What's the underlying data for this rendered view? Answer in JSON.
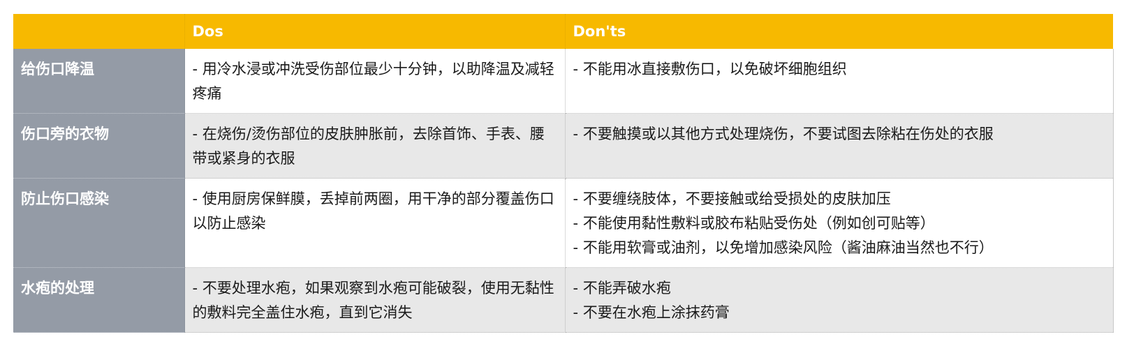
{
  "table": {
    "headers": [
      "",
      "Dos",
      "Don'ts"
    ],
    "rows": [
      {
        "label": "给伤口降温",
        "dos": [
          "- 用冷水浸或冲洗受伤部位最少十分钟，以助降温及减轻疼痛"
        ],
        "donts": [
          "- 不能用冰直接敷伤口，以免破坏细胞组织"
        ]
      },
      {
        "label": "伤口旁的衣物",
        "dos": [
          "- 在烧伤/烫伤部位的皮肤肿胀前，去除首饰、手表、腰带或紧身的衣服"
        ],
        "donts": [
          "- 不要触摸或以其他方式处理烧伤，不要试图去除粘在伤处的衣服"
        ]
      },
      {
        "label": "防止伤口感染",
        "dos": [
          "- 使用厨房保鲜膜，丢掉前两圈，用干净的部分覆盖伤口以防止感染"
        ],
        "donts": [
          "- 不要缠绕肢体，不要接触或给受损处的皮肤加压",
          "- 不能使用黏性敷料或胶布粘贴受伤处（例如创可贴等）",
          "- 不能用软膏或油剂，以免增加感染风险（酱油麻油当然也不行）"
        ]
      },
      {
        "label": "水疱的处理",
        "dos": [
          "- 不要处理水疱，如果观察到水疱可能破裂，使用无黏性的敷料完全盖住水疱，直到它消失"
        ],
        "donts": [
          "- 不能弄破水疱",
          "- 不要在水疱上涂抹药膏"
        ]
      }
    ]
  },
  "colors": {
    "header_bg": "#f7b900",
    "row_header_bg": "#949ba6",
    "stripe_bg": "#e8e8e8"
  }
}
